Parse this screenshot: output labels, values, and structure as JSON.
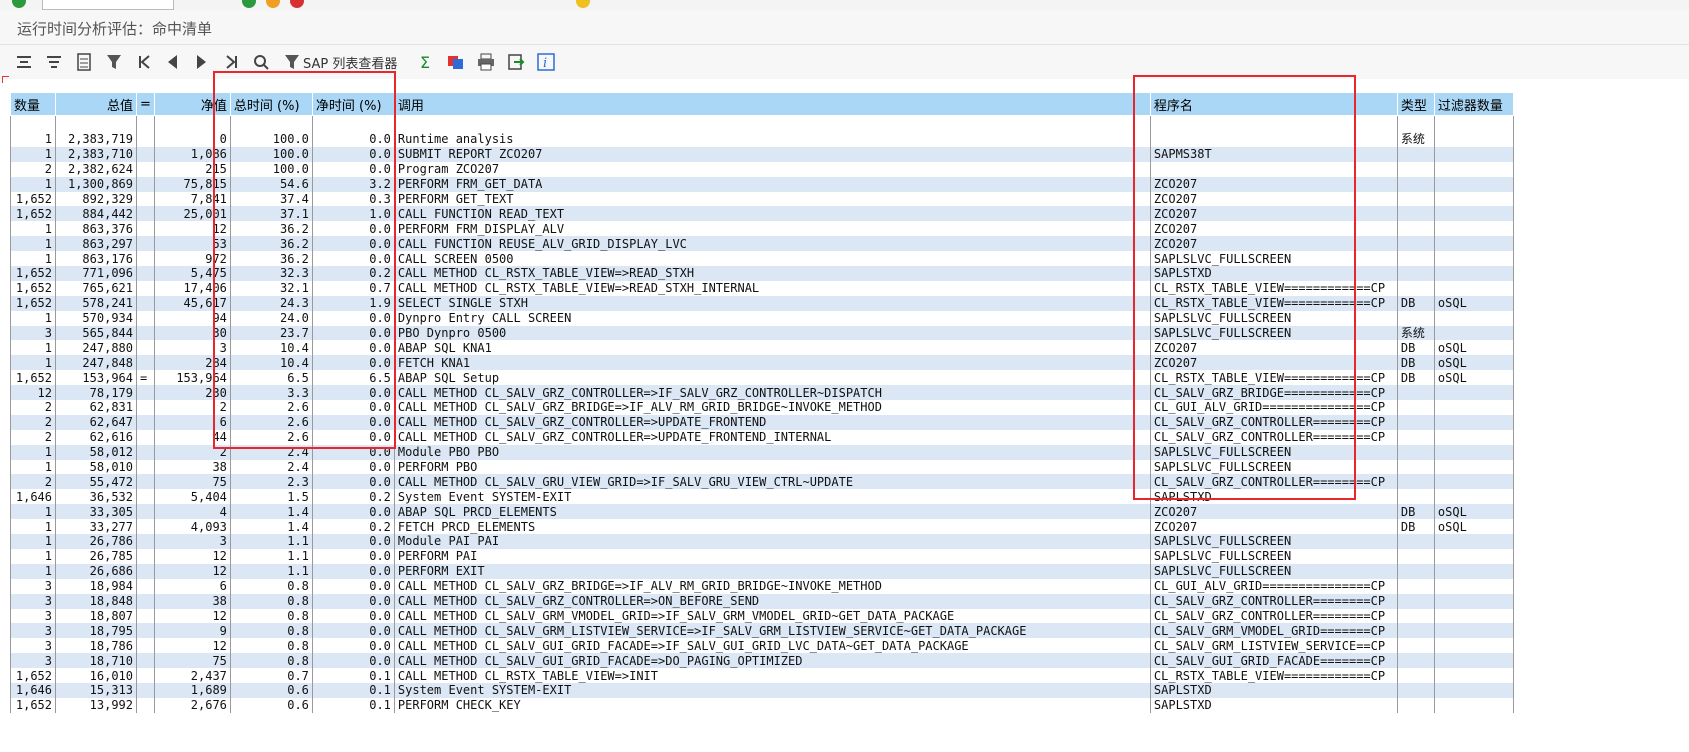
{
  "window": {
    "title": "运行时间分析评估：命中清单"
  },
  "toolbar": {
    "icons": [
      "sort-asc-icon",
      "sort-desc-icon",
      "details-icon",
      "filter-icon",
      "first-page-icon",
      "prev-page-icon",
      "next-page-icon",
      "last-page-icon",
      "find-icon",
      "sap-list-viewer-icon",
      "sum-icon",
      "layout-icon",
      "print-icon",
      "export-icon",
      "info-icon"
    ],
    "list_viewer_label": "SAP 列表查看器"
  },
  "table": {
    "headers": {
      "count": "数量",
      "gross": "总值",
      "eq": "=",
      "net": "净值",
      "gross_pct": "总时间 (%)",
      "net_pct": "净时间 (%)",
      "call": "调用",
      "program": "程序名",
      "type": "类型",
      "filter": "过滤器数量"
    },
    "rows": [
      {
        "count": "1",
        "gross": "2,383,719",
        "eq": "",
        "net": "0",
        "gross_pct": "100.0",
        "net_pct": "0.0",
        "call": "Runtime analysis",
        "program": "",
        "type": "系统",
        "filter": ""
      },
      {
        "count": "1",
        "gross": "2,383,710",
        "eq": "",
        "net": "1,086",
        "gross_pct": "100.0",
        "net_pct": "0.0",
        "call": "SUBMIT REPORT ZCO207",
        "program": "SAPMS38T",
        "type": "",
        "filter": ""
      },
      {
        "count": "2",
        "gross": "2,382,624",
        "eq": "",
        "net": "215",
        "gross_pct": "100.0",
        "net_pct": "0.0",
        "call": "Program ZCO207",
        "program": "",
        "type": "",
        "filter": ""
      },
      {
        "count": "1",
        "gross": "1,300,869",
        "eq": "",
        "net": "75,815",
        "gross_pct": "54.6",
        "net_pct": "3.2",
        "call": "PERFORM FRM_GET_DATA",
        "program": "ZCO207",
        "type": "",
        "filter": ""
      },
      {
        "count": "1,652",
        "gross": "892,329",
        "eq": "",
        "net": "7,841",
        "gross_pct": "37.4",
        "net_pct": "0.3",
        "call": "PERFORM GET_TEXT",
        "program": "ZCO207",
        "type": "",
        "filter": ""
      },
      {
        "count": "1,652",
        "gross": "884,442",
        "eq": "",
        "net": "25,001",
        "gross_pct": "37.1",
        "net_pct": "1.0",
        "call": "CALL FUNCTION READ_TEXT",
        "program": "ZCO207",
        "type": "",
        "filter": ""
      },
      {
        "count": "1",
        "gross": "863,376",
        "eq": "",
        "net": "12",
        "gross_pct": "36.2",
        "net_pct": "0.0",
        "call": "PERFORM FRM_DISPLAY_ALV",
        "program": "ZCO207",
        "type": "",
        "filter": ""
      },
      {
        "count": "1",
        "gross": "863,297",
        "eq": "",
        "net": "53",
        "gross_pct": "36.2",
        "net_pct": "0.0",
        "call": "CALL FUNCTION REUSE_ALV_GRID_DISPLAY_LVC",
        "program": "ZCO207",
        "type": "",
        "filter": ""
      },
      {
        "count": "1",
        "gross": "863,176",
        "eq": "",
        "net": "972",
        "gross_pct": "36.2",
        "net_pct": "0.0",
        "call": "CALL SCREEN 0500",
        "program": "SAPLSLVC_FULLSCREEN",
        "type": "",
        "filter": ""
      },
      {
        "count": "1,652",
        "gross": "771,096",
        "eq": "",
        "net": "5,475",
        "gross_pct": "32.3",
        "net_pct": "0.2",
        "call": "CALL METHOD CL_RSTX_TABLE_VIEW=>READ_STXH",
        "program": "SAPLSTXD",
        "type": "",
        "filter": ""
      },
      {
        "count": "1,652",
        "gross": "765,621",
        "eq": "",
        "net": "17,406",
        "gross_pct": "32.1",
        "net_pct": "0.7",
        "call": "CALL METHOD CL_RSTX_TABLE_VIEW=>READ_STXH_INTERNAL",
        "program": "CL_RSTX_TABLE_VIEW============CP",
        "type": "",
        "filter": ""
      },
      {
        "count": "1,652",
        "gross": "578,241",
        "eq": "",
        "net": "45,617",
        "gross_pct": "24.3",
        "net_pct": "1.9",
        "call": "SELECT SINGLE STXH",
        "program": "CL_RSTX_TABLE_VIEW============CP",
        "type": "DB",
        "filter": "oSQL"
      },
      {
        "count": "1",
        "gross": "570,934",
        "eq": "",
        "net": "94",
        "gross_pct": "24.0",
        "net_pct": "0.0",
        "call": "Dynpro Entry CALL SCREEN",
        "program": "SAPLSLVC_FULLSCREEN",
        "type": "",
        "filter": ""
      },
      {
        "count": "3",
        "gross": "565,844",
        "eq": "",
        "net": "30",
        "gross_pct": "23.7",
        "net_pct": "0.0",
        "call": "PBO Dynpro 0500",
        "program": "SAPLSLVC_FULLSCREEN",
        "type": "系统",
        "filter": ""
      },
      {
        "count": "1",
        "gross": "247,880",
        "eq": "",
        "net": "3",
        "gross_pct": "10.4",
        "net_pct": "0.0",
        "call": "ABAP SQL KNA1",
        "program": "ZCO207",
        "type": "DB",
        "filter": "oSQL"
      },
      {
        "count": "1",
        "gross": "247,848",
        "eq": "",
        "net": "284",
        "gross_pct": "10.4",
        "net_pct": "0.0",
        "call": "FETCH KNA1",
        "program": "ZCO207",
        "type": "DB",
        "filter": "oSQL"
      },
      {
        "count": "1,652",
        "gross": "153,964",
        "eq": "=",
        "net": "153,964",
        "gross_pct": "6.5",
        "net_pct": "6.5",
        "call": "ABAP SQL Setup",
        "program": "CL_RSTX_TABLE_VIEW============CP",
        "type": "DB",
        "filter": "oSQL"
      },
      {
        "count": "12",
        "gross": "78,179",
        "eq": "",
        "net": "230",
        "gross_pct": "3.3",
        "net_pct": "0.0",
        "call": "CALL METHOD CL_SALV_GRZ_CONTROLLER=>IF_SALV_GRZ_CONTROLLER~DISPATCH",
        "program": "CL_SALV_GRZ_BRIDGE============CP",
        "type": "",
        "filter": ""
      },
      {
        "count": "2",
        "gross": "62,831",
        "eq": "",
        "net": "2",
        "gross_pct": "2.6",
        "net_pct": "0.0",
        "call": "CALL METHOD CL_SALV_GRZ_BRIDGE=>IF_ALV_RM_GRID_BRIDGE~INVOKE_METHOD",
        "program": "CL_GUI_ALV_GRID===============CP",
        "type": "",
        "filter": ""
      },
      {
        "count": "2",
        "gross": "62,647",
        "eq": "",
        "net": "6",
        "gross_pct": "2.6",
        "net_pct": "0.0",
        "call": "CALL METHOD CL_SALV_GRZ_CONTROLLER=>UPDATE_FRONTEND",
        "program": "CL_SALV_GRZ_CONTROLLER========CP",
        "type": "",
        "filter": ""
      },
      {
        "count": "2",
        "gross": "62,616",
        "eq": "",
        "net": "44",
        "gross_pct": "2.6",
        "net_pct": "0.0",
        "call": "CALL METHOD CL_SALV_GRZ_CONTROLLER=>UPDATE_FRONTEND_INTERNAL",
        "program": "CL_SALV_GRZ_CONTROLLER========CP",
        "type": "",
        "filter": ""
      },
      {
        "count": "1",
        "gross": "58,012",
        "eq": "",
        "net": "2",
        "gross_pct": "2.4",
        "net_pct": "0.0",
        "call": "Module PBO PBO",
        "program": "SAPLSLVC_FULLSCREEN",
        "type": "",
        "filter": ""
      },
      {
        "count": "1",
        "gross": "58,010",
        "eq": "",
        "net": "38",
        "gross_pct": "2.4",
        "net_pct": "0.0",
        "call": "PERFORM PBO",
        "program": "SAPLSLVC_FULLSCREEN",
        "type": "",
        "filter": ""
      },
      {
        "count": "2",
        "gross": "55,472",
        "eq": "",
        "net": "75",
        "gross_pct": "2.3",
        "net_pct": "0.0",
        "call": "CALL METHOD CL_SALV_GRU_VIEW_GRID=>IF_SALV_GRU_VIEW_CTRL~UPDATE",
        "program": "CL_SALV_GRZ_CONTROLLER========CP",
        "type": "",
        "filter": ""
      },
      {
        "count": "1,646",
        "gross": "36,532",
        "eq": "",
        "net": "5,404",
        "gross_pct": "1.5",
        "net_pct": "0.2",
        "call": "System Event SYSTEM-EXIT",
        "program": "SAPLSTXD",
        "type": "",
        "filter": ""
      },
      {
        "count": "1",
        "gross": "33,305",
        "eq": "",
        "net": "4",
        "gross_pct": "1.4",
        "net_pct": "0.0",
        "call": "ABAP SQL PRCD_ELEMENTS",
        "program": "ZCO207",
        "type": "DB",
        "filter": "oSQL"
      },
      {
        "count": "1",
        "gross": "33,277",
        "eq": "",
        "net": "4,093",
        "gross_pct": "1.4",
        "net_pct": "0.2",
        "call": "FETCH PRCD_ELEMENTS",
        "program": "ZCO207",
        "type": "DB",
        "filter": "oSQL"
      },
      {
        "count": "1",
        "gross": "26,786",
        "eq": "",
        "net": "3",
        "gross_pct": "1.1",
        "net_pct": "0.0",
        "call": "Module PAI PAI",
        "program": "SAPLSLVC_FULLSCREEN",
        "type": "",
        "filter": ""
      },
      {
        "count": "1",
        "gross": "26,785",
        "eq": "",
        "net": "12",
        "gross_pct": "1.1",
        "net_pct": "0.0",
        "call": "PERFORM PAI",
        "program": "SAPLSLVC_FULLSCREEN",
        "type": "",
        "filter": ""
      },
      {
        "count": "1",
        "gross": "26,686",
        "eq": "",
        "net": "12",
        "gross_pct": "1.1",
        "net_pct": "0.0",
        "call": "PERFORM EXIT",
        "program": "SAPLSLVC_FULLSCREEN",
        "type": "",
        "filter": ""
      },
      {
        "count": "3",
        "gross": "18,984",
        "eq": "",
        "net": "6",
        "gross_pct": "0.8",
        "net_pct": "0.0",
        "call": "CALL METHOD CL_SALV_GRZ_BRIDGE=>IF_ALV_RM_GRID_BRIDGE~INVOKE_METHOD",
        "program": "CL_GUI_ALV_GRID===============CP",
        "type": "",
        "filter": ""
      },
      {
        "count": "3",
        "gross": "18,848",
        "eq": "",
        "net": "38",
        "gross_pct": "0.8",
        "net_pct": "0.0",
        "call": "CALL METHOD CL_SALV_GRZ_CONTROLLER=>ON_BEFORE_SEND",
        "program": "CL_SALV_GRZ_CONTROLLER========CP",
        "type": "",
        "filter": ""
      },
      {
        "count": "3",
        "gross": "18,807",
        "eq": "",
        "net": "12",
        "gross_pct": "0.8",
        "net_pct": "0.0",
        "call": "CALL METHOD CL_SALV_GRM_VMODEL_GRID=>IF_SALV_GRM_VMODEL_GRID~GET_DATA_PACKAGE",
        "program": "CL_SALV_GRZ_CONTROLLER========CP",
        "type": "",
        "filter": ""
      },
      {
        "count": "3",
        "gross": "18,795",
        "eq": "",
        "net": "9",
        "gross_pct": "0.8",
        "net_pct": "0.0",
        "call": "CALL METHOD CL_SALV_GRM_LISTVIEW_SERVICE=>IF_SALV_GRM_LISTVIEW_SERVICE~GET_DATA_PACKAGE",
        "program": "CL_SALV_GRM_VMODEL_GRID=======CP",
        "type": "",
        "filter": ""
      },
      {
        "count": "3",
        "gross": "18,786",
        "eq": "",
        "net": "12",
        "gross_pct": "0.8",
        "net_pct": "0.0",
        "call": "CALL METHOD CL_SALV_GUI_GRID_FACADE=>IF_SALV_GUI_GRID_LVC_DATA~GET_DATA_PACKAGE",
        "program": "CL_SALV_GRM_LISTVIEW_SERVICE==CP",
        "type": "",
        "filter": ""
      },
      {
        "count": "3",
        "gross": "18,710",
        "eq": "",
        "net": "75",
        "gross_pct": "0.8",
        "net_pct": "0.0",
        "call": "CALL METHOD CL_SALV_GUI_GRID_FACADE=>DO_PAGING_OPTIMIZED",
        "program": "CL_SALV_GUI_GRID_FACADE=======CP",
        "type": "",
        "filter": ""
      },
      {
        "count": "1,652",
        "gross": "16,010",
        "eq": "",
        "net": "2,437",
        "gross_pct": "0.7",
        "net_pct": "0.1",
        "call": "CALL METHOD CL_RSTX_TABLE_VIEW=>INIT",
        "program": "CL_RSTX_TABLE_VIEW============CP",
        "type": "",
        "filter": ""
      },
      {
        "count": "1,646",
        "gross": "15,313",
        "eq": "",
        "net": "1,689",
        "gross_pct": "0.6",
        "net_pct": "0.1",
        "call": "System Event SYSTEM-EXIT",
        "program": "SAPLSTXD",
        "type": "",
        "filter": ""
      },
      {
        "count": "1,652",
        "gross": "13,992",
        "eq": "",
        "net": "2,676",
        "gross_pct": "0.6",
        "net_pct": "0.1",
        "call": "PERFORM CHECK_KEY",
        "program": "SAPLSTXD",
        "type": "",
        "filter": ""
      }
    ]
  },
  "colors": {
    "header_bg": "#a9d7f5",
    "alt_row_bg": "#dbe7f5",
    "highlight_box": "#e8262c"
  }
}
